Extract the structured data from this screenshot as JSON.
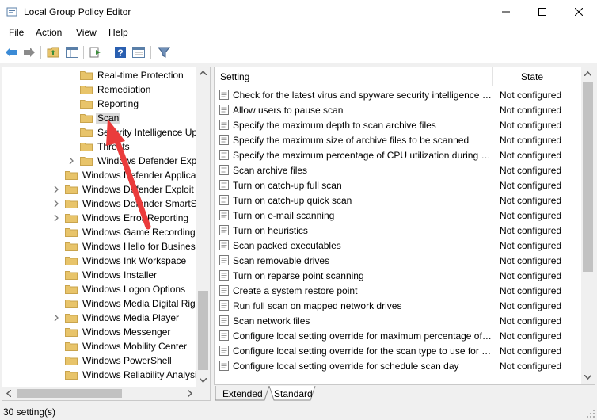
{
  "window": {
    "title": "Local Group Policy Editor"
  },
  "menu": [
    "File",
    "Action",
    "View",
    "Help"
  ],
  "tree": {
    "items": [
      {
        "label": "Real-time Protection",
        "indent": 2,
        "expander": false
      },
      {
        "label": "Remediation",
        "indent": 2,
        "expander": false
      },
      {
        "label": "Reporting",
        "indent": 2,
        "expander": false
      },
      {
        "label": "Scan",
        "indent": 2,
        "expander": false,
        "selected": true
      },
      {
        "label": "Security Intelligence Upd",
        "indent": 2,
        "expander": false
      },
      {
        "label": "Threats",
        "indent": 2,
        "expander": false
      },
      {
        "label": "Windows Defender Expl",
        "indent": 2,
        "expander": true
      },
      {
        "label": "Windows Defender Applicat",
        "indent": 1,
        "expander": false
      },
      {
        "label": "Windows Defender Exploit G",
        "indent": 1,
        "expander": true
      },
      {
        "label": "Windows Defender SmartSc",
        "indent": 1,
        "expander": true
      },
      {
        "label": "Windows Error Reporting",
        "indent": 1,
        "expander": true
      },
      {
        "label": "Windows Game Recording a",
        "indent": 1,
        "expander": false
      },
      {
        "label": "Windows Hello for Business",
        "indent": 1,
        "expander": false
      },
      {
        "label": "Windows Ink Workspace",
        "indent": 1,
        "expander": false
      },
      {
        "label": "Windows Installer",
        "indent": 1,
        "expander": false
      },
      {
        "label": "Windows Logon Options",
        "indent": 1,
        "expander": false
      },
      {
        "label": "Windows Media Digital Righ",
        "indent": 1,
        "expander": false
      },
      {
        "label": "Windows Media Player",
        "indent": 1,
        "expander": true
      },
      {
        "label": "Windows Messenger",
        "indent": 1,
        "expander": false
      },
      {
        "label": "Windows Mobility Center",
        "indent": 1,
        "expander": false
      },
      {
        "label": "Windows PowerShell",
        "indent": 1,
        "expander": false
      },
      {
        "label": "Windows Reliability Analysi",
        "indent": 1,
        "expander": false
      }
    ]
  },
  "list": {
    "header_setting": "Setting",
    "header_state": "State",
    "rows": [
      {
        "name": "Check for the latest virus and spyware security intelligence before running a scheduled scan",
        "state": "Not configured"
      },
      {
        "name": "Allow users to pause scan",
        "state": "Not configured"
      },
      {
        "name": "Specify the maximum depth to scan archive files",
        "state": "Not configured"
      },
      {
        "name": "Specify the maximum size of archive files to be scanned",
        "state": "Not configured"
      },
      {
        "name": "Specify the maximum percentage of CPU utilization during a scan",
        "state": "Not configured"
      },
      {
        "name": "Scan archive files",
        "state": "Not configured"
      },
      {
        "name": "Turn on catch-up full scan",
        "state": "Not configured"
      },
      {
        "name": "Turn on catch-up quick scan",
        "state": "Not configured"
      },
      {
        "name": "Turn on e-mail scanning",
        "state": "Not configured"
      },
      {
        "name": "Turn on heuristics",
        "state": "Not configured"
      },
      {
        "name": "Scan packed executables",
        "state": "Not configured"
      },
      {
        "name": "Scan removable drives",
        "state": "Not configured"
      },
      {
        "name": "Turn on reparse point scanning",
        "state": "Not configured"
      },
      {
        "name": "Create a system restore point",
        "state": "Not configured"
      },
      {
        "name": "Run full scan on mapped network drives",
        "state": "Not configured"
      },
      {
        "name": "Scan network files",
        "state": "Not configured"
      },
      {
        "name": "Configure local setting override for maximum percentage of CPU utilization",
        "state": "Not configured"
      },
      {
        "name": "Configure local setting override for the scan type to use for scheduled scan",
        "state": "Not configured"
      },
      {
        "name": "Configure local setting override for schedule scan day",
        "state": "Not configured"
      }
    ]
  },
  "tabs": [
    "Extended",
    "Standard"
  ],
  "status": {
    "text": "30 setting(s)"
  },
  "colors": {
    "folder": "#e8c46a",
    "arrow": "#ea3b3b",
    "accent": "#1e73be"
  }
}
